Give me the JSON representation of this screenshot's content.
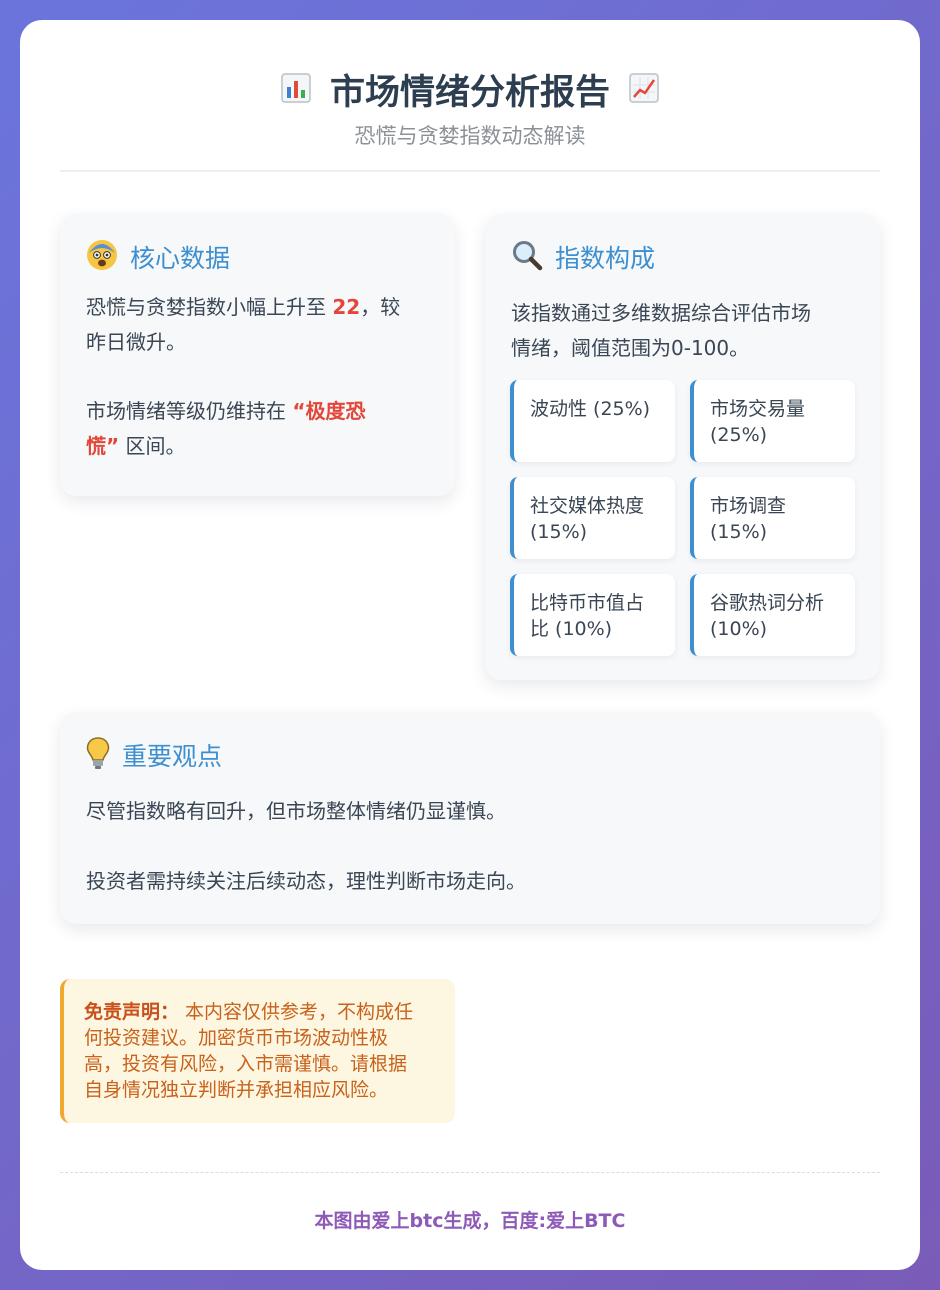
{
  "header": {
    "title": "市场情绪分析报告",
    "subtitle": "恐慌与贪婪指数动态解读",
    "icon_left": "bar-chart-icon",
    "icon_right": "trend-up-icon"
  },
  "core": {
    "icon": "fearful-face-icon",
    "title": "核心数据",
    "p1_before": "恐慌与贪婪指数小幅上升至 ",
    "p1_value": "22",
    "p1_after": "，较",
    "p1_line2": "昨日微升。",
    "p2_before": "市场情绪等级仍维持在 ",
    "p2_highlight_a": "“极度恐",
    "p2_highlight_b": "慌”",
    "p2_after": " 区间。"
  },
  "composition": {
    "icon": "magnifier-icon",
    "title": "指数构成",
    "desc_line1": "该指数通过多维数据综合评估市场",
    "desc_line2": "情绪，阈值范围为0-100。",
    "factors": [
      {
        "line1": "波动性 (25%)",
        "line2": ""
      },
      {
        "line1": "市场交易量",
        "line2": "(25%)"
      },
      {
        "line1": "社交媒体热度",
        "line2": "(15%)"
      },
      {
        "line1": "市场调查",
        "line2": "(15%)"
      },
      {
        "line1": "比特币市值占",
        "line2": "比 (10%)"
      },
      {
        "line1": "谷歌热词分析",
        "line2": "(10%)"
      }
    ]
  },
  "viewpoint": {
    "icon": "lightbulb-icon",
    "title": "重要观点",
    "p1": "尽管指数略有回升，但市场整体情绪仍显谨慎。",
    "p2": "投资者需持续关注后续动态，理性判断市场走向。"
  },
  "disclaimer": {
    "label": "免责声明：",
    "line1": " 本内容仅供参考，不构成任",
    "line2": "何投资建议。加密货币市场波动性极",
    "line3": "高，投资有风险，入市需谨慎。请根据",
    "line4": "自身情况独立判断并承担相应风险。"
  },
  "footer": {
    "text": "本图由爱上btc生成，百度:爱上BTC"
  },
  "colors": {
    "accent_blue": "#3d8fd0",
    "highlight_red": "#e2473a",
    "disclaimer_orange": "#c8621c",
    "footer_purple": "#8e5ab8"
  }
}
